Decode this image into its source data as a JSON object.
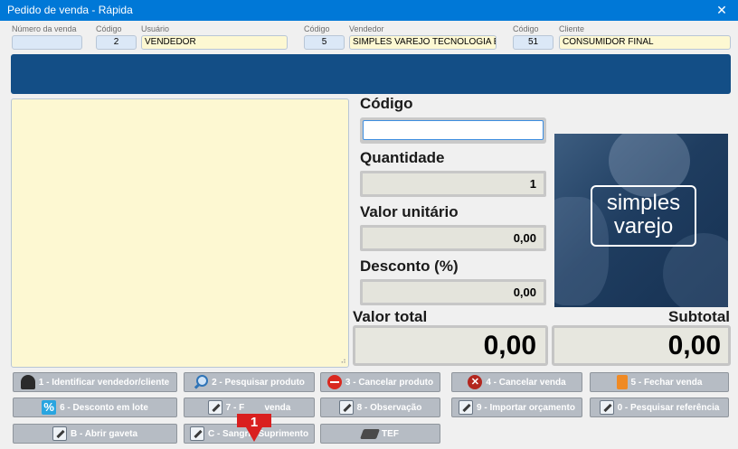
{
  "window": {
    "title": "Pedido de venda - Rápida",
    "close_glyph": "✕"
  },
  "header": {
    "numero_label": "Número da venda",
    "numero_value": "",
    "usuario_codigo_label": "Código",
    "usuario_codigo_value": "2",
    "usuario_label": "Usuário",
    "usuario_value": "VENDEDOR",
    "vendedor_codigo_label": "Código",
    "vendedor_codigo_value": "5",
    "vendedor_label": "Vendedor",
    "vendedor_value": "SIMPLES VAREJO TECNOLOGIA E D",
    "cliente_codigo_label": "Código",
    "cliente_codigo_value": "51",
    "cliente_label": "Cliente",
    "cliente_value": "CONSUMIDOR FINAL"
  },
  "entry": {
    "codigo_label": "Código",
    "codigo_value": "",
    "quantidade_label": "Quantidade",
    "quantidade_value": "1",
    "valor_unitario_label": "Valor unitário",
    "valor_unitario_value": "0,00",
    "desconto_label": "Desconto (%)",
    "desconto_value": "0,00"
  },
  "totals": {
    "valor_total_label": "Valor total",
    "valor_total_value": "0,00",
    "subtotal_label": "Subtotal",
    "subtotal_value": "0,00"
  },
  "logo": {
    "line1": "simples",
    "line2": "varejo"
  },
  "buttons": {
    "identificar": "1 - Identificar vendedor/cliente",
    "pesquisar": "2 - Pesquisar produto",
    "cancelar_produto": "3 - Cancelar produto",
    "cancelar_venda": "4 - Cancelar venda",
    "fechar_venda": "5 - Fechar venda",
    "desconto_lote": "6 - Desconto em lote",
    "btn7": "7 - F        venda",
    "observacao": "8 - Observação",
    "importar": "9 - Importar orçamento",
    "pesquisar_ref": "0 - Pesquisar referência",
    "abrir_gaveta": "B - Abrir gaveta",
    "sangria": "C - Sangria/Suprimento",
    "tef": "TEF"
  },
  "marker": {
    "number": "1",
    "color": "#d91f1f"
  },
  "colors": {
    "titlebar": "#0078d7",
    "banner": "#134e86",
    "field_bg": "#fdf8d2",
    "button_bg": "#b6bcc4"
  }
}
